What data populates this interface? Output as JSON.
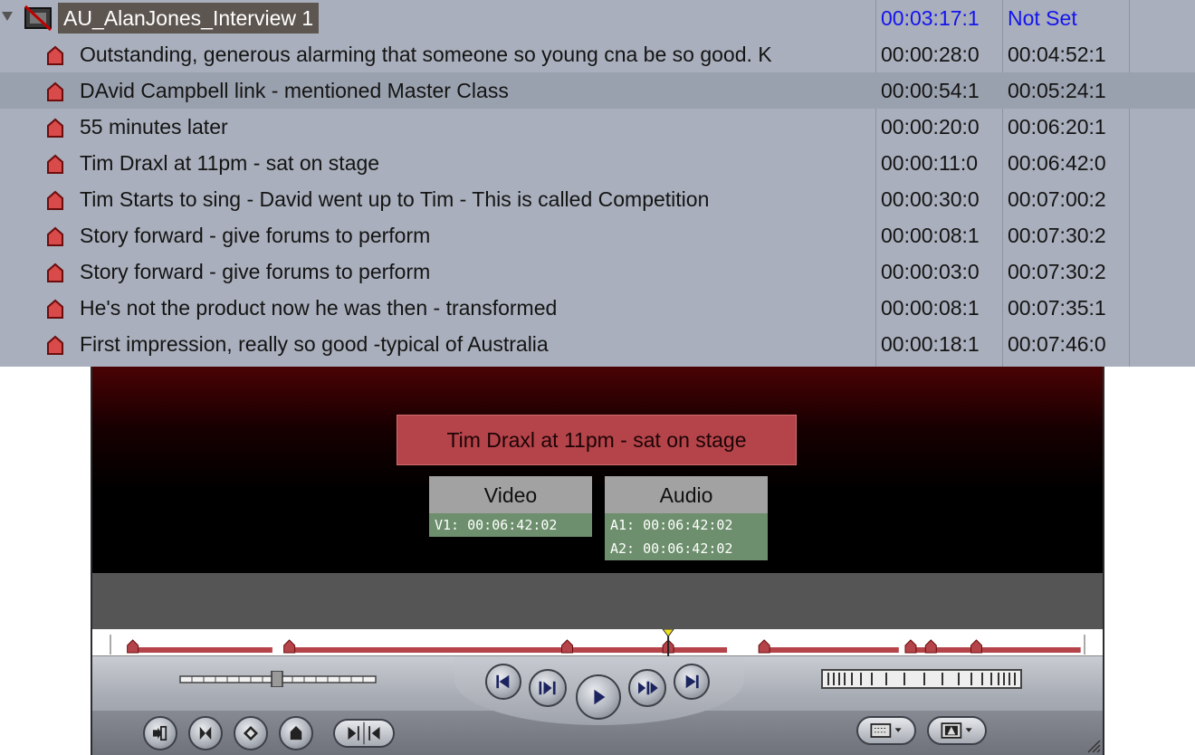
{
  "browser": {
    "clip": {
      "name": "AU_AlanJones_Interview 1",
      "duration": "00:03:17:1",
      "in_point": "Not Set",
      "icon": "clip-icon"
    },
    "markers": [
      {
        "name": "Outstanding, generous alarming that someone so young cna be so good. K",
        "duration": "00:00:28:0",
        "in": "00:04:52:1"
      },
      {
        "name": "DAvid Campbell link - mentioned Master Class",
        "duration": "00:00:54:1",
        "in": "00:05:24:1"
      },
      {
        "name": "55 minutes later",
        "duration": "00:00:20:0",
        "in": "00:06:20:1"
      },
      {
        "name": "Tim Draxl at 11pm - sat on stage",
        "duration": "00:00:11:0",
        "in": "00:06:42:0"
      },
      {
        "name": "Tim Starts to sing - David went up to Tim - This is called Competition",
        "duration": "00:00:30:0",
        "in": "00:07:00:2"
      },
      {
        "name": "Story forward - give forums to perform",
        "duration": "00:00:08:1",
        "in": "00:07:30:2"
      },
      {
        "name": "Story forward - give forums to perform",
        "duration": "00:00:03:0",
        "in": "00:07:30:2"
      },
      {
        "name": "He's not the product now he was then - transformed",
        "duration": "00:00:08:1",
        "in": "00:07:35:1"
      },
      {
        "name": "First impression, really so good -typical of Australia",
        "duration": "00:00:18:1",
        "in": "00:07:46:0"
      }
    ],
    "marker_icon": "marker-icon",
    "highlight_color": "#9aa1ae"
  },
  "viewer": {
    "overlay_marker": "Tim Draxl at 11pm - sat on stage",
    "video": {
      "title": "Video",
      "lines": [
        "V1: 00:06:42:02"
      ]
    },
    "audio": {
      "title": "Audio",
      "lines": [
        "A1: 00:06:42:02",
        "A2: 00:06:42:02"
      ]
    },
    "colors": {
      "marker_red": "#b5444a",
      "panel_green": "#6d8f6d"
    },
    "scrubber_markers": [
      {
        "start": 0.04,
        "end": 0.18
      },
      {
        "start": 0.195,
        "end": 0.47
      },
      {
        "start": 0.47,
        "end": 0.57
      },
      {
        "start": 0.57,
        "end": 0.63
      },
      {
        "start": 0.665,
        "end": 0.8
      },
      {
        "start": 0.81,
        "end": 0.83
      },
      {
        "start": 0.83,
        "end": 0.875
      },
      {
        "start": 0.875,
        "end": 0.98
      }
    ],
    "playhead": 0.57,
    "transport_buttons": [
      "go-to-previous-edit-icon",
      "play-in-to-out-icon",
      "play-icon",
      "play-around-current-icon",
      "go-to-next-edit-icon"
    ],
    "lower_buttons": [
      "match-frame-icon",
      "mark-clip-icon",
      "add-keyframe-icon",
      "add-marker-icon",
      "mark-in-out-icon"
    ],
    "popup_buttons": [
      "zoom-view-icon",
      "view-options-icon"
    ]
  }
}
